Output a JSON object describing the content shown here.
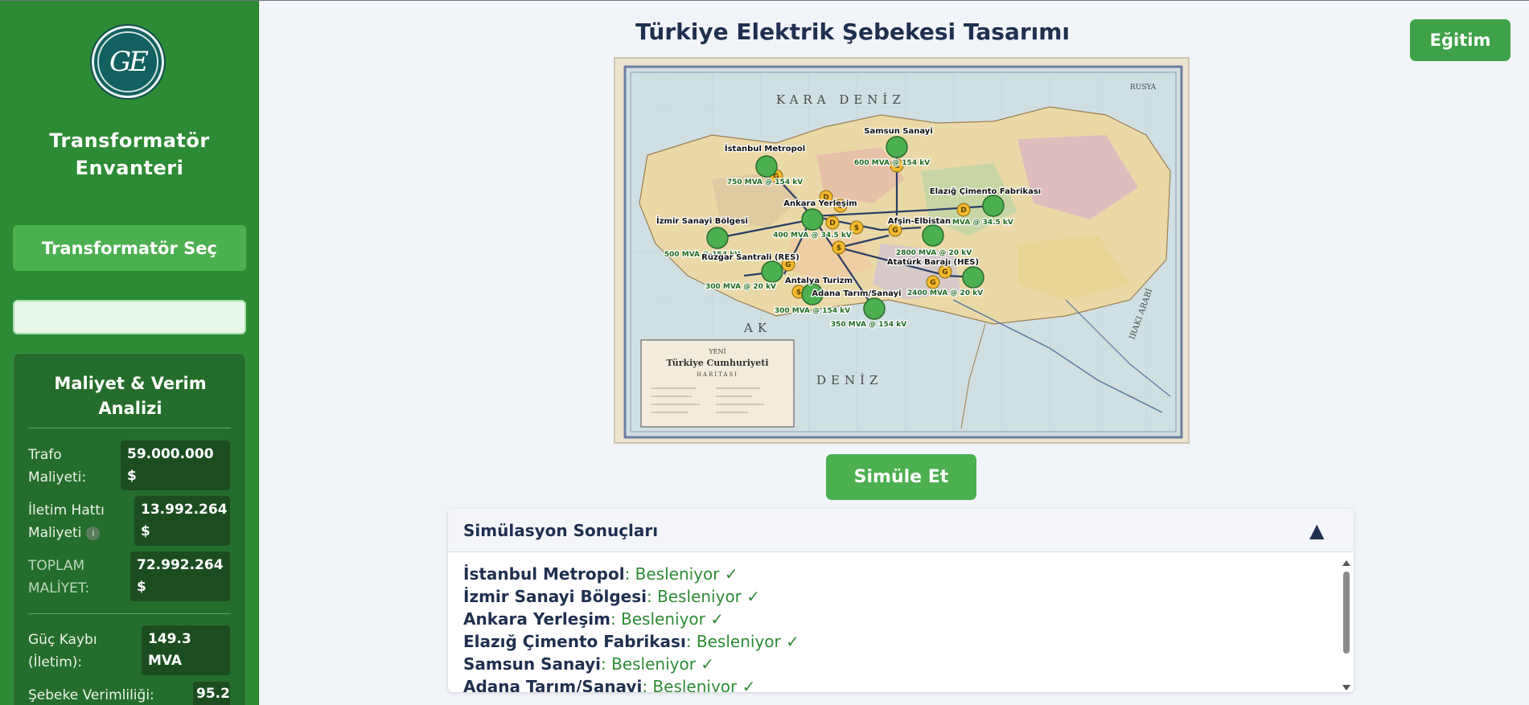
{
  "sidebar": {
    "logo_text": "GE",
    "title_line1": "Transformatör",
    "title_line2": "Envanteri",
    "select_button": "Transformatör Seç",
    "search_value": "",
    "cost": {
      "title_line1": "Maliyet & Verim",
      "title_line2": "Analizi",
      "trafo_label_1": "Trafo",
      "trafo_label_2": "Maliyeti:",
      "trafo_value_1": "59.000.000",
      "trafo_value_2": "$",
      "line_label_1": "İletim Hattı",
      "line_label_2": "Maliyeti",
      "line_info": "i",
      "line_value_1": "13.992.264",
      "line_value_2": "$",
      "total_label_1": "TOPLAM",
      "total_label_2": "MALİYET:",
      "total_value_1": "72.992.264",
      "total_value_2": "$",
      "loss_label_1": "Güç Kaybı",
      "loss_label_2": "(İletim):",
      "loss_value_1": "149.3",
      "loss_value_2": "MVA",
      "eff_label": "Şebeke Verimliliği:",
      "eff_value": "95.2 %"
    }
  },
  "main": {
    "title": "Türkiye Elektrik Şebekesi Tasarımı",
    "education_button": "Eğitim",
    "simulate_button": "Simüle Et"
  },
  "map": {
    "sea_north": "KARA DENİZ",
    "sea_south_1": "AK",
    "sea_south_2": "DENİZ",
    "region_ne": "RUSYA",
    "region_se": "IRAKI ARABİ",
    "cartouche_1": "YENİ",
    "cartouche_2": "Türkiye Cumhuriyeti",
    "cartouche_3": "HARİTASI",
    "marker_g": "G",
    "marker_d": "D",
    "marker_s": "$",
    "nodes": [
      {
        "name": "İstanbul Metropol",
        "cap": "750 MVA @ 154 kV"
      },
      {
        "name": "Samsun Sanayi",
        "cap": "600 MVA @ 154 kV"
      },
      {
        "name": "Elazığ Çimento Fabrikası",
        "cap": "180 MVA @ 34.5 kV"
      },
      {
        "name": "Ankara Yerleşim",
        "cap": "400 MVA @ 34.5 kV"
      },
      {
        "name": "İzmir Sanayi Bölgesi",
        "cap": "500 MVA @ 154 kV"
      },
      {
        "name": "Afşin-Elbistan",
        "cap": "2800 MVA @ 20 kV"
      },
      {
        "name": "Rüzgar Santrali (RES)",
        "cap": "300 MVA @ 20 kV"
      },
      {
        "name": "Atatürk Barajı (HES)",
        "cap": "2400 MVA @ 20 kV"
      },
      {
        "name": "Antalya Turizm",
        "cap": "300 MVA @ 154 kV"
      },
      {
        "name": "Adana Tarım/Sanayi",
        "cap": "350 MVA @ 154 kV"
      }
    ]
  },
  "results": {
    "title": "Simülasyon Sonuçları",
    "toggle": "▲",
    "items": [
      {
        "name": "İstanbul Metropol",
        "status": ": Besleniyor ✓"
      },
      {
        "name": "İzmir Sanayi Bölgesi",
        "status": ": Besleniyor ✓"
      },
      {
        "name": "Ankara Yerleşim",
        "status": ": Besleniyor ✓"
      },
      {
        "name": "Elazığ Çimento Fabrikası",
        "status": ": Besleniyor ✓"
      },
      {
        "name": "Samsun Sanayi",
        "status": ": Besleniyor ✓"
      },
      {
        "name": "Adana Tarım/Sanayi",
        "status": ": Besleniyor ✓"
      }
    ]
  },
  "colors": {
    "sidebar": "#2e8b35",
    "button": "#4caf50",
    "title": "#1f3050",
    "status_ok": "#2e8b35",
    "node": "#4caf50",
    "marker": "#f5b82e"
  }
}
